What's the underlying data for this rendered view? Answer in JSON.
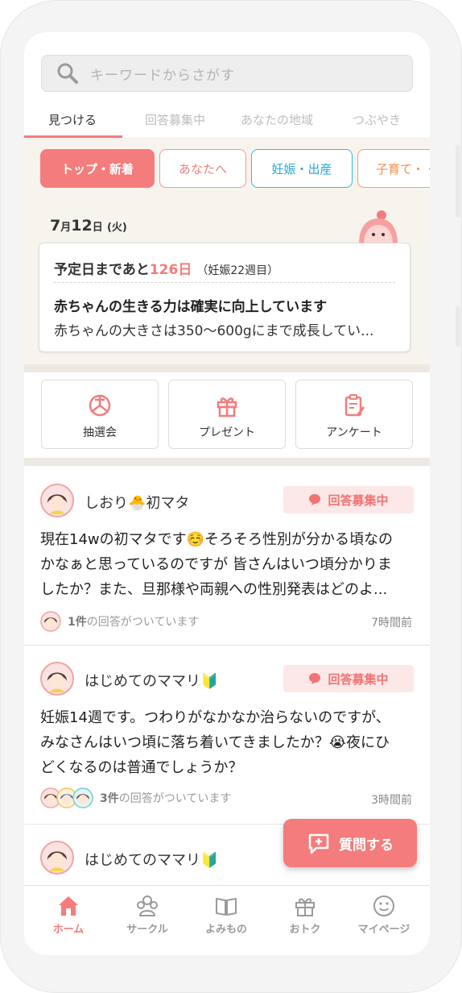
{
  "search": {
    "placeholder": "キーワードからさがす"
  },
  "tabs": [
    {
      "label": "見つける",
      "active": true
    },
    {
      "label": "回答募集中"
    },
    {
      "label": "あなたの地域"
    },
    {
      "label": "つぶやき"
    }
  ],
  "chips": [
    {
      "label": "トップ・新着",
      "active": true
    },
    {
      "label": "あなたへ"
    },
    {
      "label": "妊娠・出産"
    },
    {
      "label": "子育て・・"
    }
  ],
  "date": {
    "month": "7",
    "month_suffix": "月",
    "day": "12",
    "day_suffix": "日",
    "weekday": "(火)"
  },
  "pregnancy": {
    "prefix": "予定日まであと",
    "days": "126日",
    "week": "（妊娠22週目）",
    "headline": "赤ちゃんの生きる力は確実に向上しています",
    "body": "赤ちゃんの大きさは350〜600gにまで成長してい..."
  },
  "actions": [
    {
      "label": "抽選会",
      "icon": "lottery-icon"
    },
    {
      "label": "プレゼント",
      "icon": "gift-icon"
    },
    {
      "label": "アンケート",
      "icon": "survey-icon"
    }
  ],
  "posts": [
    {
      "username": "しおり🐣初マタ",
      "badge": "回答募集中",
      "lines": [
        "現在14wの初マタです☺️そろそろ性別が分かる頃なの",
        "かなぁと思っているのですが 皆さんはいつ頃分かりま",
        "したか？また、旦那様や両親への性別発表はどのよ..."
      ],
      "answer_count": "1件",
      "answer_text": "の回答がついています",
      "time": "7時間前"
    },
    {
      "username": "はじめてのママリ🔰",
      "badge": "回答募集中",
      "lines": [
        "妊娠14週です。つわりがなかなか治らないのですが、",
        "みなさんはいつ頃に落ち着いてきましたか？😭夜にひ",
        "どくなるのは普通でしょうか？"
      ],
      "answer_count": "3件",
      "answer_text": "の回答がついています",
      "time": "3時間前"
    },
    {
      "username": "はじめてのママリ🔰"
    }
  ],
  "fab": {
    "label": "質問する"
  },
  "bottom_nav": [
    {
      "label": "ホーム",
      "active": true,
      "icon": "home-icon"
    },
    {
      "label": "サークル",
      "icon": "circle-icon"
    },
    {
      "label": "よみもの",
      "icon": "book-icon"
    },
    {
      "label": "おトク",
      "icon": "gift-icon"
    },
    {
      "label": "マイページ",
      "icon": "smile-icon"
    }
  ],
  "colors": {
    "accent": "#f47c7c",
    "blue": "#3ab8d9",
    "orange": "#f3a25c",
    "beige": "#f7f4ee"
  }
}
